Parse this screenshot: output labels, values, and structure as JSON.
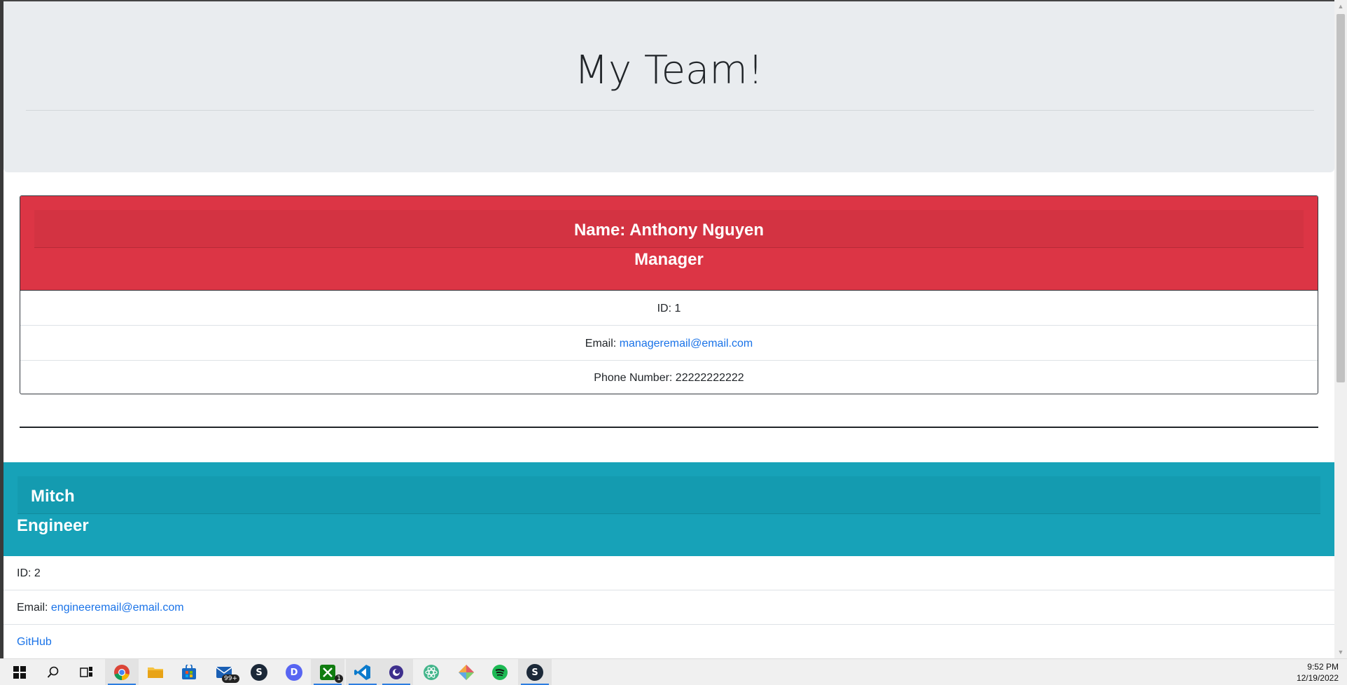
{
  "page": {
    "title": "My Team!"
  },
  "manager": {
    "name_line": "Name: Anthony Nguyen",
    "role": "Manager",
    "id_line": "ID: 1",
    "email_prefix": "Email: ",
    "email": "manageremail@email.com",
    "phone_line": "Phone Number: 22222222222",
    "header_color": "#dc3545"
  },
  "engineer": {
    "name": "Mitch",
    "role": "Engineer",
    "id_line": "ID: 2",
    "email_prefix": "Email: ",
    "email": "engineeremail@email.com",
    "github_label": "GitHub",
    "header_color": "#17a2b8"
  },
  "taskbar": {
    "icons": [
      "windows-start-icon",
      "search-icon",
      "task-view-icon",
      "chrome-icon",
      "file-explorer-icon",
      "microsoft-store-icon",
      "mail-icon",
      "steam-icon",
      "discord-icon",
      "xbox-icon",
      "vscode-icon",
      "browser-icon",
      "atom-icon",
      "kite-icon",
      "spotify-icon",
      "steam-icon"
    ],
    "mail_badge": "99+",
    "xbox_badge": "1",
    "time": "9:52 PM",
    "date": "12/19/2022"
  }
}
